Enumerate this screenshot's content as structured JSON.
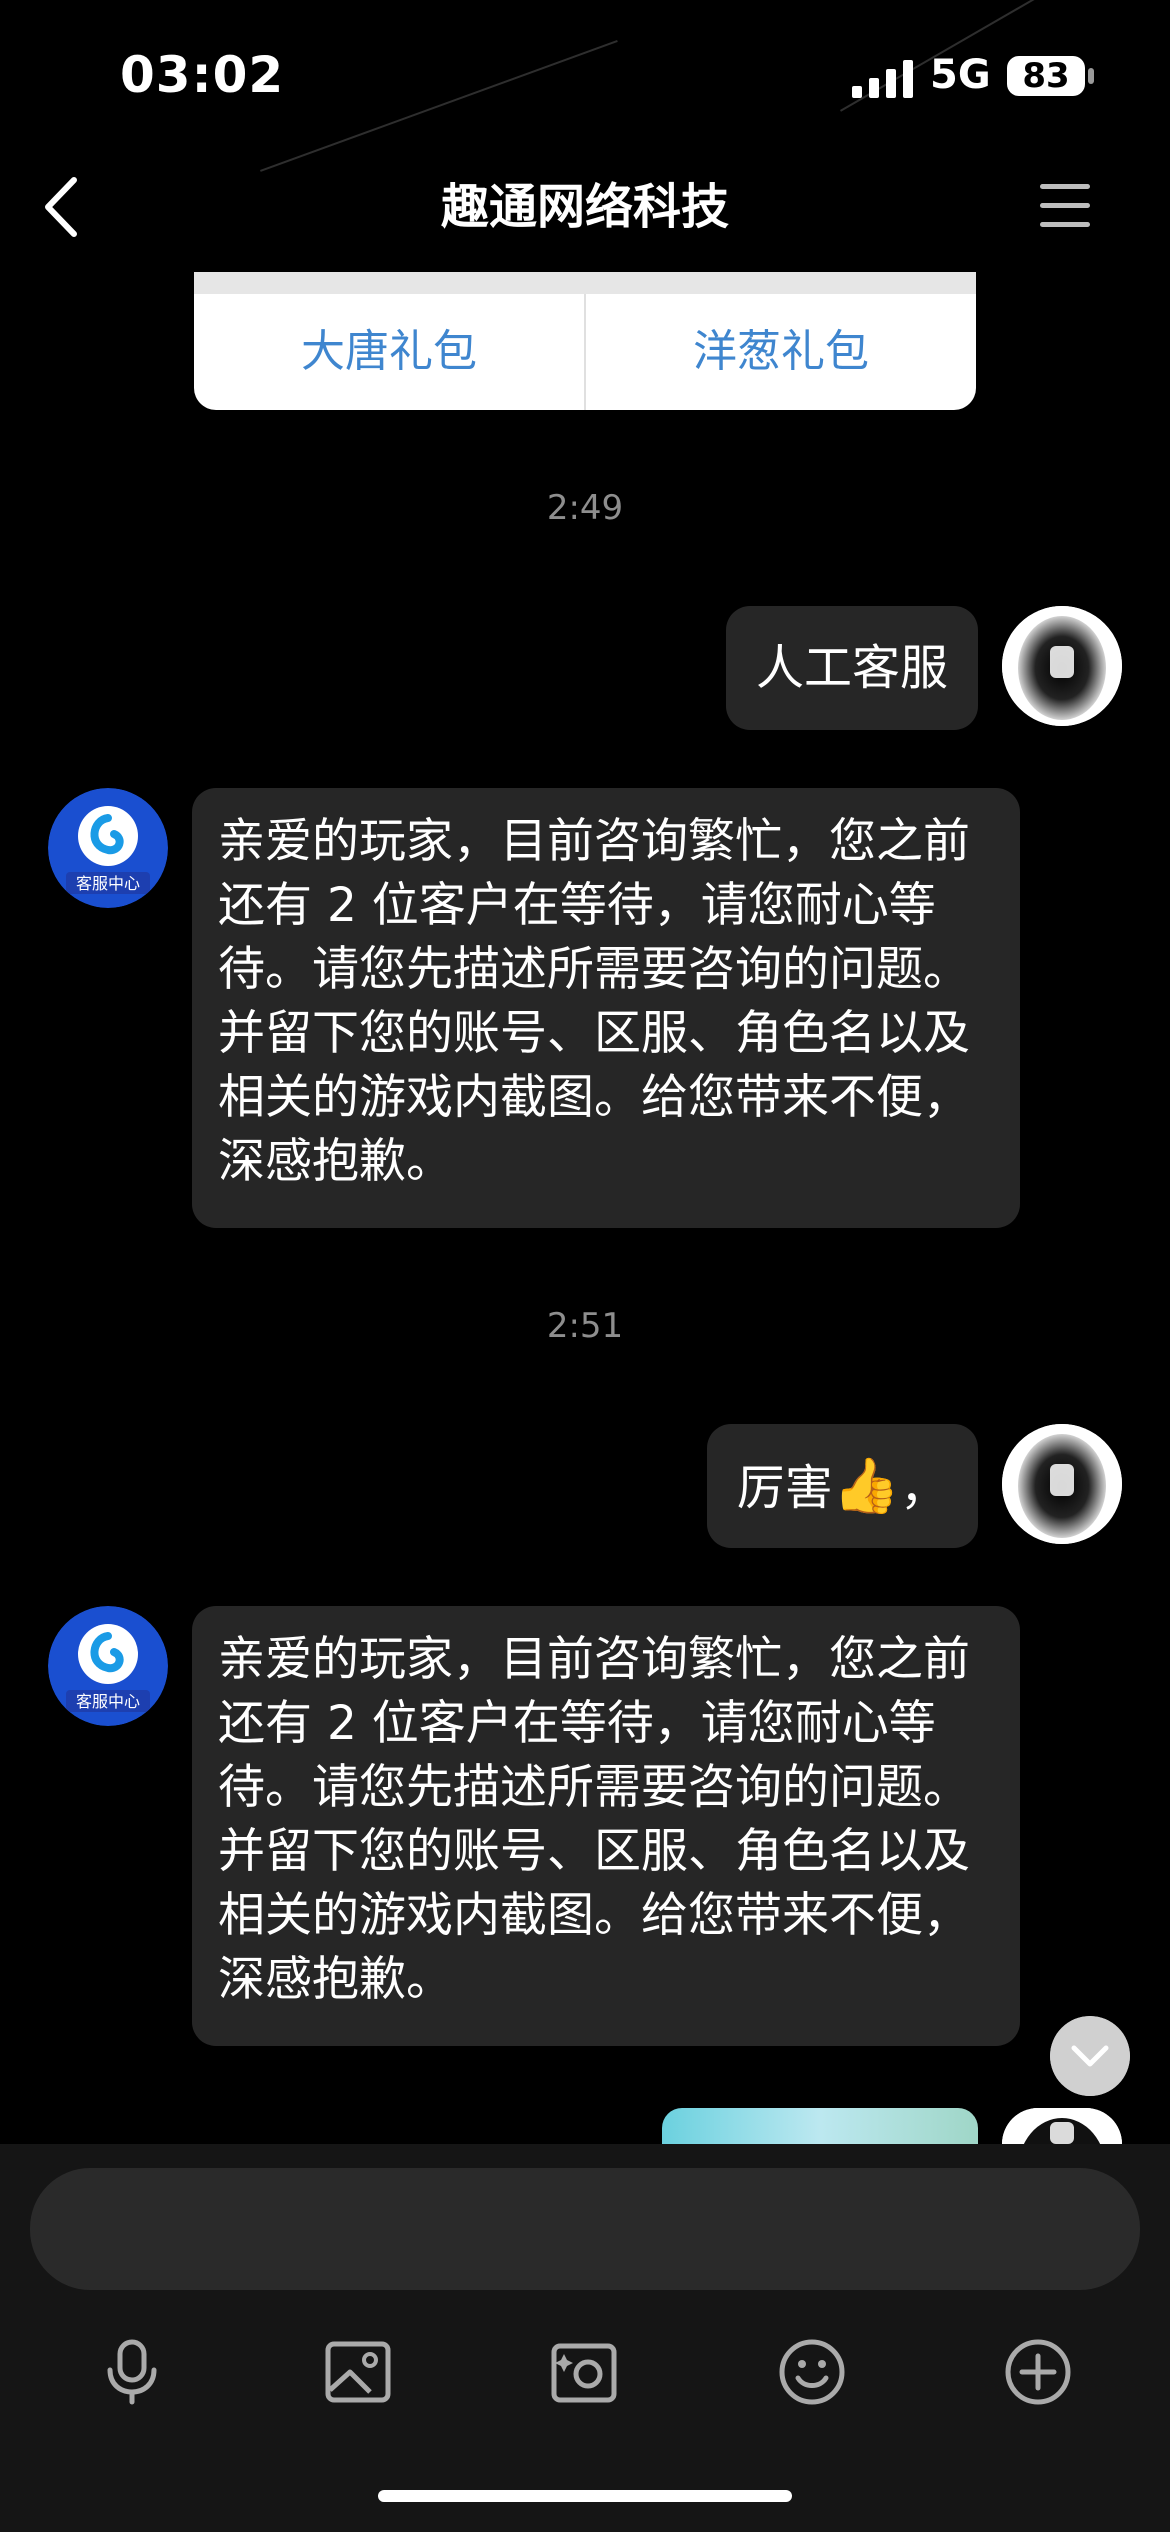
{
  "status_bar": {
    "time": "03:02",
    "network": "5G",
    "battery": "83"
  },
  "nav": {
    "title": "趣通网络科技",
    "back_icon": "chevron-left-icon",
    "menu_icon": "hamburger-menu-icon"
  },
  "card": {
    "buttons": [
      "大唐礼包",
      "洋葱礼包"
    ]
  },
  "messages": [
    {
      "type": "timestamp",
      "text": "2:49"
    },
    {
      "type": "sent",
      "text": "人工客服"
    },
    {
      "type": "received",
      "avatar_label": "客服中心",
      "text": "亲爱的玩家，目前咨询繁忙，您之前还有 2 位客户在等待，请您耐心等待。请您先描述所需要咨询的问题。并留下您的账号、区服、角色名以及相关的游戏内截图。给您带来不便，深感抱歉。"
    },
    {
      "type": "timestamp",
      "text": "2:51"
    },
    {
      "type": "sent",
      "text": "厉害",
      "emoji": "👍",
      "suffix": "，"
    },
    {
      "type": "received",
      "avatar_label": "客服中心",
      "text": "亲爱的玩家，目前咨询繁忙，您之前还有 2 位客户在等待，请您耐心等待。请您先描述所需要咨询的问题。并留下您的账号、区服、角色名以及相关的游戏内截图。给您带来不便，深感抱歉。"
    }
  ],
  "input": {
    "placeholder": ""
  },
  "toolbar": {
    "icons": [
      "microphone-icon",
      "image-icon",
      "camera-icon",
      "emoji-icon",
      "add-icon"
    ]
  },
  "colors": {
    "background": "#000000",
    "bubble": "#262626",
    "card_link": "#3f86cf",
    "service_avatar": "#1a4fd0"
  }
}
